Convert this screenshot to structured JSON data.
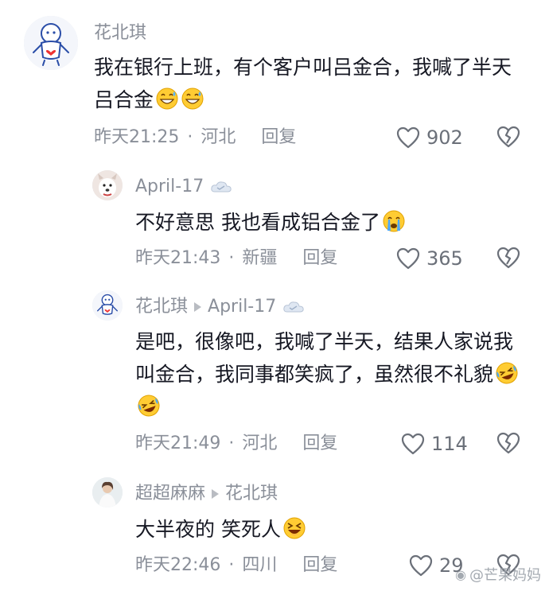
{
  "comments": [
    {
      "author": "花北琪",
      "text": "我在银行上班，有个客户叫吕金合，我喊了半天吕合金",
      "emoji_icon": "grinning-sweat-emoji x2",
      "time": "昨天21:25",
      "location": "河北",
      "reply_label": "回复",
      "likes": "902"
    },
    {
      "author": "April-17",
      "text": "不好意思 我也看成铝合金了",
      "emoji_icon": "crying-face-emoji",
      "time": "昨天21:43",
      "location": "新疆",
      "reply_label": "回复",
      "likes": "365"
    },
    {
      "author": "花北琪",
      "reply_to": "April-17",
      "text": "是吧，很像吧，我喊了半天，结果人家说我叫金合，我同事都笑疯了，虽然很不礼貌",
      "emoji_icon": "rolling-laughing-emoji x2",
      "time": "昨天21:49",
      "location": "河北",
      "reply_label": "回复",
      "likes": "114"
    },
    {
      "author": "超超麻麻",
      "reply_to": "花北琪",
      "text": "大半夜的 笑死人",
      "emoji_icon": "laughing-squint-emoji",
      "time": "昨天22:46",
      "location": "四川",
      "reply_label": "回复",
      "likes": "29"
    }
  ],
  "watermark": "@芒果妈妈",
  "icons": {
    "like": "heart-outline-icon",
    "dislike": "broken-heart-icon",
    "reply_arrow": "triangle-right-icon",
    "badge": "cloud-badge-icon"
  },
  "colors": {
    "text": "#161823",
    "muted": "#8a8f99",
    "emoji_yellow": "#ffcc33"
  }
}
